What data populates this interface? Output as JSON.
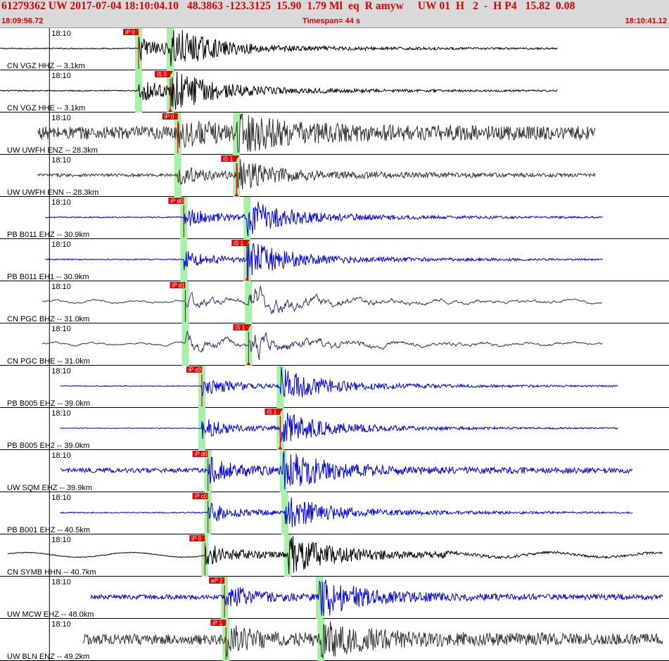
{
  "header": {
    "title": "61279362 UW 2017-07-04 18:10:04.10   48.3863 -123.3125  15.90  1.79 Ml  eq  R amyw     UW 01  H   2  -  H P4   15.82  0.08",
    "start_time": "18:09:56.72",
    "timespan": "Timespan=  44 s",
    "end_time": "18:10:41.12"
  },
  "colors": {
    "header_bg": "#d9d9d9",
    "header_text": "#dd0000",
    "pick_flag": "#ee0000",
    "window_bar": "#a8f0a8",
    "trace_black": "#000000",
    "trace_gray": "#333333",
    "trace_blue": "#0000dd"
  },
  "tick_label": "18:10",
  "traces": [
    {
      "label": "CN VGZ HHZ -- 3.1km",
      "color": "black",
      "pick_text": "iP 0",
      "tp": 9.2,
      "ts": 11.3,
      "pick_s": false,
      "amp": "impulsive",
      "trim_start": 0,
      "trim_end": 37,
      "noise": 0.03
    },
    {
      "label": "CN VGZ HHE -- 3.1km",
      "color": "black",
      "pick_text": "iS 0",
      "tp": 9.2,
      "ts": 11.3,
      "pick_s": true,
      "amp": "impulsive",
      "trim_start": 0,
      "trim_end": 37,
      "noise": 0.03
    },
    {
      "label": "UW UWFH ENZ -- 28.3km",
      "color": "gray",
      "pick_text": "iP 0",
      "tp": 11.8,
      "ts": 15.7,
      "pick_s": false,
      "amp": "noisy",
      "trim_start": 2.5,
      "trim_end": 39.5,
      "noise": 0.35
    },
    {
      "label": "UW UWFH ENN -- 28.3km",
      "color": "gray",
      "pick_text": "iS 1",
      "tp": 11.8,
      "ts": 15.7,
      "pick_s": true,
      "amp": "quiet",
      "trim_start": 2.5,
      "trim_end": 39.5,
      "noise": 0.08
    },
    {
      "label": "PB B011 EHZ -- 30.9km",
      "color": "blue",
      "pick_text": "iP d0",
      "tp": 12.2,
      "ts": 16.4,
      "pick_s": false,
      "amp": "moderate",
      "trim_start": 3,
      "trim_end": 40,
      "noise": 0.03
    },
    {
      "label": "PB B011 EH1 -- 30.9km",
      "color": "blue",
      "pick_text": "iS 1",
      "tp": 12.2,
      "ts": 16.4,
      "pick_s": true,
      "amp": "moderate",
      "trim_start": 3,
      "trim_end": 40,
      "noise": 0.03
    },
    {
      "label": "CN PGC BHZ -- 31.0km",
      "color": "purple",
      "pick_text": "iP d1",
      "tp": 12.3,
      "ts": 16.5,
      "pick_s": false,
      "amp": "smooth",
      "trim_start": 2.8,
      "trim_end": 40,
      "noise": 0.05
    },
    {
      "label": "CN PGC BHE -- 31.0km",
      "color": "purple",
      "pick_text": "iS 1",
      "tp": 12.3,
      "ts": 16.5,
      "pick_s": true,
      "amp": "smooth",
      "trim_start": 2.8,
      "trim_end": 40,
      "noise": 0.05
    },
    {
      "label": "PB B005 EHZ -- 39.0km",
      "color": "blue",
      "pick_text": "iP c0",
      "tp": 13.4,
      "ts": 18.6,
      "pick_s": false,
      "amp": "moderate",
      "trim_start": 4,
      "trim_end": 41,
      "noise": 0.02
    },
    {
      "label": "PB B005 EH2 -- 39.0km",
      "color": "blue",
      "pick_text": "iS 1",
      "tp": 13.4,
      "ts": 18.6,
      "pick_s": true,
      "amp": "moderate",
      "trim_start": 4,
      "trim_end": 41,
      "noise": 0.02
    },
    {
      "label": "UW SQM EHZ -- 39.9km",
      "color": "blue",
      "pick_text": "iP d0",
      "tp": 13.8,
      "ts": 18.8,
      "pick_s": false,
      "amp": "strong",
      "trim_start": 4,
      "trim_end": 42,
      "noise": 0.12
    },
    {
      "label": "PB B001 EHZ -- 40.5km",
      "color": "blue",
      "pick_text": "iP c0",
      "tp": 13.8,
      "ts": 18.9,
      "pick_s": false,
      "amp": "moderate",
      "trim_start": 4,
      "trim_end": 42,
      "noise": 0.03
    },
    {
      "label": "CN SYMB HHN -- 40.7km",
      "color": "black",
      "pick_text": "iP 0",
      "tp": 13.6,
      "ts": 19.1,
      "pick_s": false,
      "amp": "longperiod",
      "trim_start": 0.5,
      "trim_end": 44,
      "noise": 0.08
    },
    {
      "label": "UW MCW EHZ -- 48.0km",
      "color": "blue",
      "pick_text": "eP 2",
      "tp": 14.9,
      "ts": 21.2,
      "pick_s": false,
      "amp": "strong",
      "trim_start": 6,
      "trim_end": 44,
      "noise": 0.12
    },
    {
      "label": "UW BLN ENZ -- 49.2km",
      "color": "gray",
      "pick_text": "iP 1",
      "tp": 15.0,
      "ts": 21.3,
      "pick_s": false,
      "amp": "noisy",
      "trim_start": 5.5,
      "trim_end": 44,
      "noise": 0.28
    }
  ]
}
